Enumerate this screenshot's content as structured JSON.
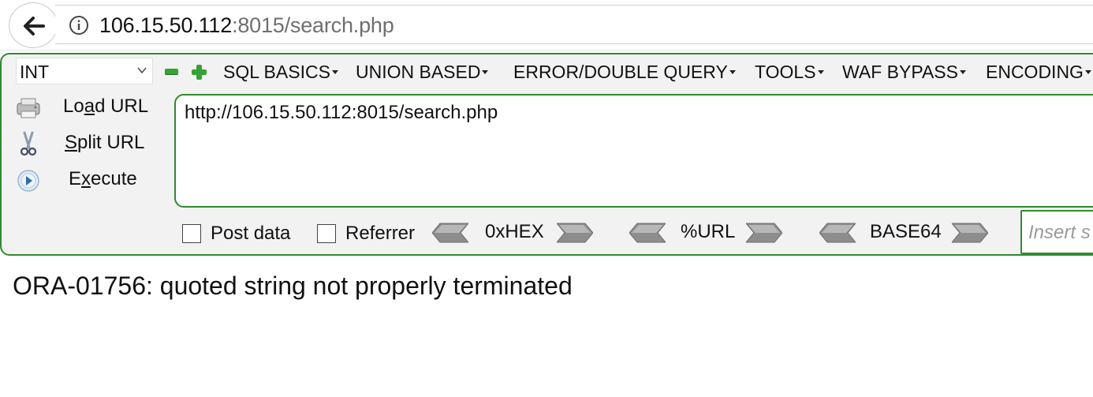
{
  "browser": {
    "address": {
      "host": "106.15.50.112",
      "rest": ":8015/search.php"
    }
  },
  "hackbar": {
    "select_value": "INT",
    "menus": [
      "SQL BASICS",
      "UNION BASED",
      "ERROR/DOUBLE QUERY",
      "TOOLS",
      "WAF BYPASS",
      "ENCODING"
    ],
    "buttons": {
      "load_url_pre": "Lo",
      "load_url_key": "a",
      "load_url_post": "d URL",
      "split_url_key": "S",
      "split_url_post": "plit URL",
      "execute_pre": "E",
      "execute_key": "x",
      "execute_post": "ecute"
    },
    "url_value": "http://106.15.50.112:8015/search.php",
    "checkboxes": {
      "post_data": "Post data",
      "referrer": "Referrer"
    },
    "encoders": [
      "0xHEX",
      "%URL",
      "BASE64"
    ],
    "insert_placeholder": "Insert s",
    "accent_color": "#2e8b2e"
  },
  "page": {
    "error_text": "ORA-01756: quoted string not properly terminated"
  }
}
